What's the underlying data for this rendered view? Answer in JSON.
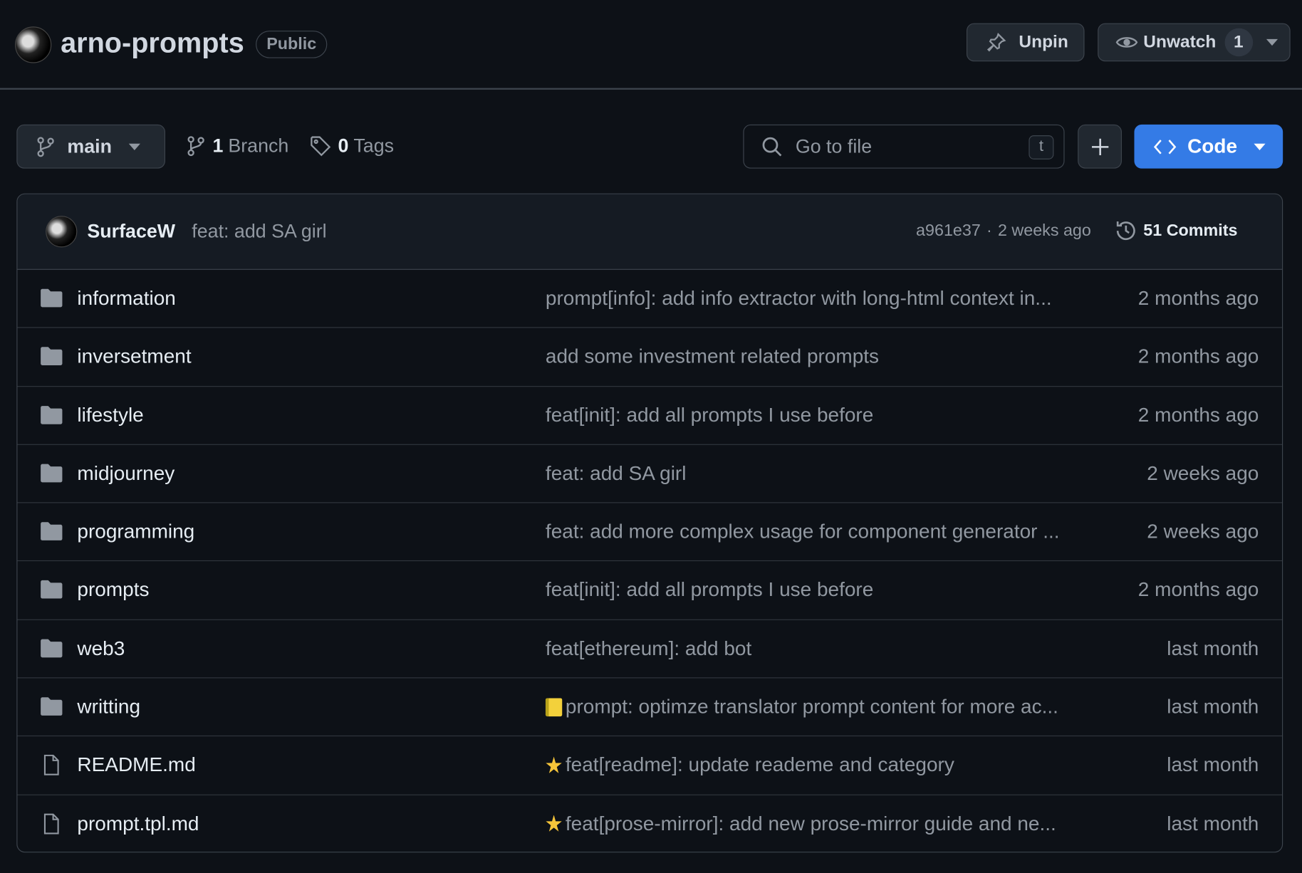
{
  "repo": {
    "name": "arno-prompts",
    "visibility": "Public"
  },
  "actions": {
    "unpin": "Unpin",
    "unwatch": "Unwatch",
    "watch_count": "1"
  },
  "toolbar": {
    "branch": "main",
    "branch_count": "1",
    "branch_label": "Branch",
    "tag_count": "0",
    "tag_label": "Tags",
    "search_placeholder": "Go to file",
    "search_shortcut": "t",
    "code_label": "Code"
  },
  "latest_commit": {
    "author": "SurfaceW",
    "message": "feat: add SA girl",
    "hash": "a961e37",
    "separator": "·",
    "time": "2 weeks ago",
    "commit_count": "51 Commits"
  },
  "files": [
    {
      "type": "folder",
      "name": "information",
      "message": "prompt[info]: add info extractor with long-html context in...",
      "date": "2 months ago"
    },
    {
      "type": "folder",
      "name": "inversetment",
      "message": "add some investment related prompts",
      "date": "2 months ago"
    },
    {
      "type": "folder",
      "name": "lifestyle",
      "message": "feat[init]: add all prompts I use before",
      "date": "2 months ago"
    },
    {
      "type": "folder",
      "name": "midjourney",
      "message": "feat: add SA girl",
      "date": "2 weeks ago"
    },
    {
      "type": "folder",
      "name": "programming",
      "message": "feat: add more complex usage for component generator ...",
      "date": "2 weeks ago"
    },
    {
      "type": "folder",
      "name": "prompts",
      "message": "feat[init]: add all prompts I use before",
      "date": "2 months ago"
    },
    {
      "type": "folder",
      "name": "web3",
      "message": "feat[ethereum]: add bot",
      "date": "last month"
    },
    {
      "type": "folder",
      "name": "writting",
      "emoji": "notebook",
      "message": "prompt: optimze translator prompt content for more ac...",
      "date": "last month"
    },
    {
      "type": "file",
      "name": "README.md",
      "emoji": "star",
      "message": "feat[readme]: update reademe and category",
      "date": "last month"
    },
    {
      "type": "file",
      "name": "prompt.tpl.md",
      "emoji": "star",
      "message": "feat[prose-mirror]: add new prose-mirror guide and ne...",
      "date": "last month"
    }
  ],
  "colors": {
    "background": "#0d1117",
    "accent": "#347be6",
    "border": "#3d444d",
    "muted": "#9198a1"
  }
}
